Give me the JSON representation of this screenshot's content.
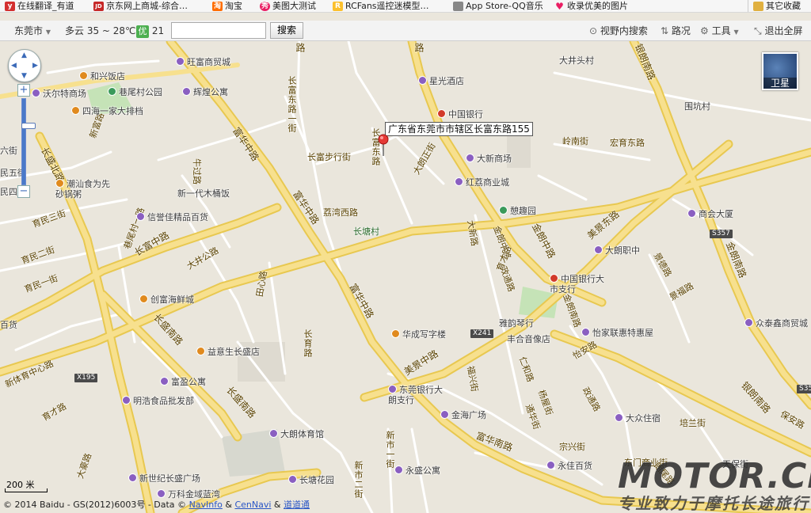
{
  "bookmarks": [
    {
      "label": "在线翻译_有道",
      "icon": "youdao-icon",
      "color": "#d32f2f",
      "glyph": "y"
    },
    {
      "label": "京东网上商城-综合…",
      "icon": "jd-icon",
      "color": "#c62828",
      "glyph": "JD"
    },
    {
      "label": "淘宝",
      "icon": "taobao-icon",
      "color": "#ff6d00",
      "glyph": "淘"
    },
    {
      "label": "美图大测试",
      "icon": "meitu-icon",
      "color": "#e91e63",
      "glyph": "秀"
    },
    {
      "label": "RCFans遥控迷模型…",
      "icon": "rcfans-icon",
      "color": "#fbc02d",
      "glyph": "R"
    },
    {
      "label": "App Store-QQ音乐",
      "icon": "apple-icon",
      "color": "#888888",
      "glyph": ""
    },
    {
      "label": "收录优美的图片",
      "icon": "heart-icon",
      "color": "#e91e63",
      "glyph": "♥"
    },
    {
      "label": "其它收藏",
      "icon": "folder-icon",
      "color": "#e0b040",
      "glyph": ""
    }
  ],
  "toolbar": {
    "city": "东莞市",
    "weather": "多云 35 ~ 28℃",
    "aqi_badge": "优",
    "aqi_value": "21",
    "search_placeholder": "",
    "search_button": "搜索",
    "view_search": "视野内搜索",
    "traffic": "路况",
    "tools": "工具",
    "exit_fullscreen": "退出全屏"
  },
  "map": {
    "satellite_label": "卫星",
    "callout": "广东省东莞市市辖区长富东路155",
    "callout_behind": "广东省东莞市市辖区长富东路155",
    "scale": "200 米",
    "copyright_prefix": "© 2014 Baidu - GS(2012)6003号 - Data ©",
    "copyright_navinfo": "NavInfo",
    "copyright_and": "&",
    "copyright_cennavi": "CenNavi",
    "copyright_and2": "&",
    "copyright_daodaotong": "道道通",
    "watermark": "MOTOR.CN",
    "watermark_sub": "专业致力于摩托长途旅行",
    "road_labels": {
      "r1": "路",
      "r2": "路",
      "r3": "长富东路一街",
      "r4": "长富步行街",
      "r5": "长富东路",
      "r6": "大朗正街",
      "r7": "荔湾西路",
      "r8": "长盛北路",
      "r9": "长富中路",
      "r10": "大井公路",
      "r11": "牛过路",
      "r12": "富华中路",
      "r13": "富华中路",
      "r14": "富华中路",
      "r15": "长盛南路",
      "r16": "长盛南路",
      "r17": "美景中路",
      "r18": "美景东路",
      "r19": "金朗中路",
      "r20": "金朗南路",
      "r21": "金朗中路",
      "r22": "富华南路",
      "r23": "银朗南路",
      "r24": "银朗南路",
      "r25": "岭南街",
      "r26": "宏育东路",
      "r27": "新体育中心路",
      "r28": "育才路",
      "r29": "长育路",
      "r30": "新市一街",
      "r31": "新市二街",
      "r32": "仁和路",
      "r33": "杨屋街",
      "r34": "通华街",
      "r35": "政通路",
      "r36": "怡安路",
      "r37": "政通路",
      "r38": "福兴街",
      "r39": "东门商业街",
      "r40": "宗兴街",
      "r41": "培兰街",
      "r42": "保安路",
      "r43": "景德路",
      "r44": "景福路",
      "r45": "大豪路",
      "r46": "新富路",
      "r47": "育民一街",
      "r48": "育民二街",
      "r49": "育民三街",
      "r50": "田心路",
      "r51": "巷尾村一路",
      "r52": "民五街",
      "r53": "民四街",
      "r54": "六街",
      "r55": "百货",
      "r56": "大新路",
      "r57": "金朗南路",
      "r58": "育才路",
      "r59": "朗尾路"
    },
    "shields": {
      "s1": "X241",
      "s2": "X195",
      "s3": "S357",
      "s4": "S35"
    },
    "pois": {
      "p1": "旺富商贸城",
      "p2": "和兴饭店",
      "p3": "沃尔特商场",
      "p4": "巷尾村公园",
      "p5": "辉煌公寓",
      "p6": "四海一家大排档",
      "p7": "星光酒店",
      "p8": "中国银行",
      "p9": "大新商场",
      "p10": "红荔商业城",
      "p11": "憩趣园",
      "p12": "潮汕食为先砂锅粥",
      "p13": "新一代木桶饭",
      "p14": "信誉佳精品百货",
      "p15": "长塘村",
      "p16": "创富海鲜城",
      "p17": "益意生长盛店",
      "p18": "华成写字楼",
      "p19": "雅韵琴行",
      "p20": "丰合音像店",
      "p21": "怡家联惠特惠屋",
      "p22": "中国银行大市支行",
      "p23": "大朗职中",
      "p24": "商会大厦",
      "p25": "众泰鑫商贸城",
      "p26": "围坑村",
      "p27": "大井头村",
      "p28": "东莞银行大朗支行",
      "p29": "金海广场",
      "p30": "富盈公寓",
      "p31": "明浩食品批发部",
      "p32": "大朗体育馆",
      "p33": "新世纪长盛广场",
      "p34": "万科金域蓝湾",
      "p35": "长塘花园",
      "p36": "永盛公寓",
      "p37": "永佳百货",
      "p38": "大众住宿",
      "p39": "天保街"
    }
  }
}
